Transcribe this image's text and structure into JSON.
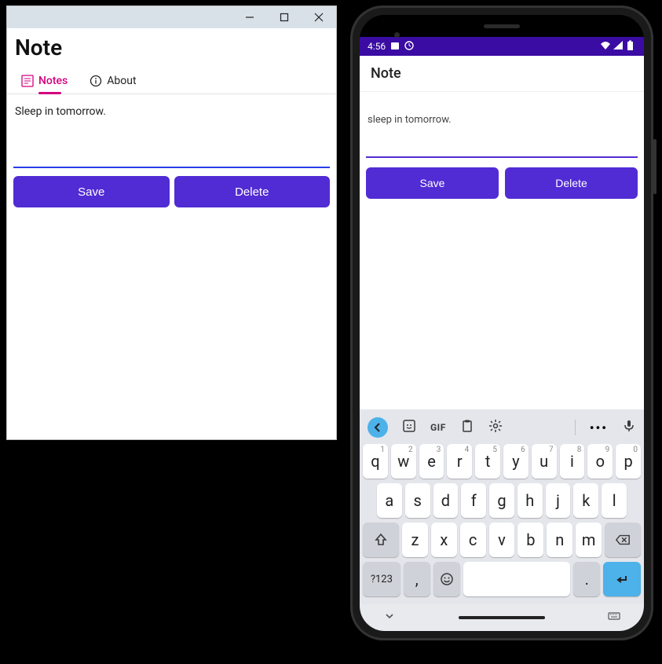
{
  "desktop": {
    "title": "Note",
    "tabs": {
      "notes": {
        "label": "Notes",
        "icon": "notes-icon"
      },
      "about": {
        "label": "About",
        "icon": "info-icon"
      }
    },
    "note_text": "Sleep in tomorrow.",
    "buttons": {
      "save": "Save",
      "delete": "Delete"
    }
  },
  "phone": {
    "status": {
      "time": "4:56"
    },
    "appbar_title": "Note",
    "note_text": "sleep in tomorrow.",
    "buttons": {
      "save": "Save",
      "delete": "Delete"
    },
    "keyboard": {
      "gif_label": "GIF",
      "row1": [
        {
          "k": "q",
          "n": "1"
        },
        {
          "k": "w",
          "n": "2"
        },
        {
          "k": "e",
          "n": "3"
        },
        {
          "k": "r",
          "n": "4"
        },
        {
          "k": "t",
          "n": "5"
        },
        {
          "k": "y",
          "n": "6"
        },
        {
          "k": "u",
          "n": "7"
        },
        {
          "k": "i",
          "n": "8"
        },
        {
          "k": "o",
          "n": "9"
        },
        {
          "k": "p",
          "n": "0"
        }
      ],
      "row2": [
        "a",
        "s",
        "d",
        "f",
        "g",
        "h",
        "j",
        "k",
        "l"
      ],
      "row3": [
        "z",
        "x",
        "c",
        "v",
        "b",
        "n",
        "m"
      ],
      "sym_label": "?123",
      "comma": ",",
      "period": "."
    }
  }
}
